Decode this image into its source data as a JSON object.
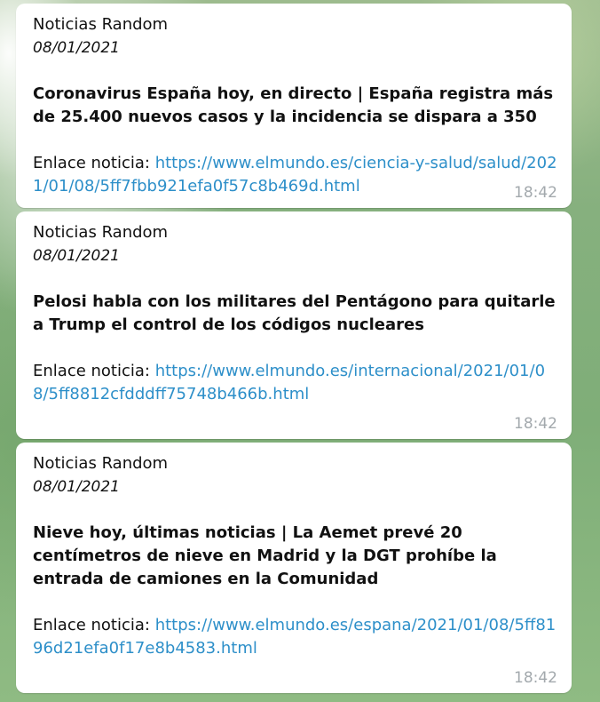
{
  "messages": [
    {
      "sender": "Noticias Random",
      "date": "08/01/2021",
      "headline": "Coronavirus España hoy, en directo | España registra más de 25.400 nuevos casos y la incidencia se dispara a 350",
      "link_label": "Enlace noticia: ",
      "link_url": "https://www.elmundo.es/ciencia-y-salud/salud/2021/01/08/5ff7fbb921efa0f57c8b469d.html",
      "link_display": "https://www.elmundo.es/ciencia-y-salud/salud/2021/01/08/5ff7fbb921efa0f57c8b469d.html",
      "time": "18:42"
    },
    {
      "sender": "Noticias Random",
      "date": "08/01/2021",
      "headline": "Pelosi habla con los militares del Pentágono para quitarle a Trump el control de los códigos nucleares",
      "link_label": "Enlace noticia: ",
      "link_url": "https://www.elmundo.es/internacional/2021/01/08/5ff8812cfdddff75748b466b.html",
      "link_display": "https://www.elmundo.es/internacional/2021/01/08/5ff8812cfdddff75748b466b.html",
      "time": "18:42"
    },
    {
      "sender": "Noticias Random",
      "date": "08/01/2021",
      "headline": "Nieve hoy, últimas noticias | La Aemet prevé 20 centímetros de nieve en Madrid y la DGT prohíbe la entrada de camiones en la Comunidad",
      "link_label": "Enlace noticia: ",
      "link_url": "https://www.elmundo.es/espana/2021/01/08/5ff8196d21efa0f17e8b4583.html",
      "link_display": "https://www.elmundo.es/espana/2021/01/08/5ff8196d21efa0f17e8b4583.html",
      "time": "18:42"
    }
  ]
}
